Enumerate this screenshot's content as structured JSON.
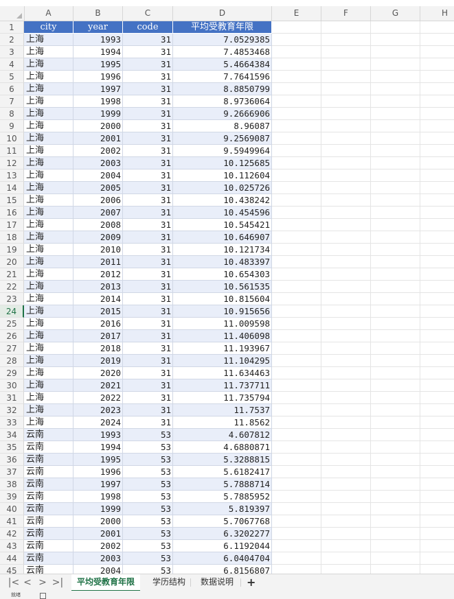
{
  "columns": [
    "A",
    "B",
    "C",
    "D",
    "E",
    "F",
    "G",
    "H"
  ],
  "header_row": {
    "row_number": "1",
    "cells": [
      "city",
      "year",
      "code",
      "平均受教育年限"
    ]
  },
  "rows": [
    {
      "r": "2",
      "city": "上海",
      "year": "1993",
      "code": "31",
      "value": "7.0529385"
    },
    {
      "r": "3",
      "city": "上海",
      "year": "1994",
      "code": "31",
      "value": "7.4853468"
    },
    {
      "r": "4",
      "city": "上海",
      "year": "1995",
      "code": "31",
      "value": "5.4664384"
    },
    {
      "r": "5",
      "city": "上海",
      "year": "1996",
      "code": "31",
      "value": "7.7641596"
    },
    {
      "r": "6",
      "city": "上海",
      "year": "1997",
      "code": "31",
      "value": "8.8850799"
    },
    {
      "r": "7",
      "city": "上海",
      "year": "1998",
      "code": "31",
      "value": "8.9736064"
    },
    {
      "r": "8",
      "city": "上海",
      "year": "1999",
      "code": "31",
      "value": "9.2666906"
    },
    {
      "r": "9",
      "city": "上海",
      "year": "2000",
      "code": "31",
      "value": "8.96087"
    },
    {
      "r": "10",
      "city": "上海",
      "year": "2001",
      "code": "31",
      "value": "9.2569087"
    },
    {
      "r": "11",
      "city": "上海",
      "year": "2002",
      "code": "31",
      "value": "9.5949964"
    },
    {
      "r": "12",
      "city": "上海",
      "year": "2003",
      "code": "31",
      "value": "10.125685"
    },
    {
      "r": "13",
      "city": "上海",
      "year": "2004",
      "code": "31",
      "value": "10.112604"
    },
    {
      "r": "14",
      "city": "上海",
      "year": "2005",
      "code": "31",
      "value": "10.025726"
    },
    {
      "r": "15",
      "city": "上海",
      "year": "2006",
      "code": "31",
      "value": "10.438242"
    },
    {
      "r": "16",
      "city": "上海",
      "year": "2007",
      "code": "31",
      "value": "10.454596"
    },
    {
      "r": "17",
      "city": "上海",
      "year": "2008",
      "code": "31",
      "value": "10.545421"
    },
    {
      "r": "18",
      "city": "上海",
      "year": "2009",
      "code": "31",
      "value": "10.646907"
    },
    {
      "r": "19",
      "city": "上海",
      "year": "2010",
      "code": "31",
      "value": "10.121734"
    },
    {
      "r": "20",
      "city": "上海",
      "year": "2011",
      "code": "31",
      "value": "10.483397"
    },
    {
      "r": "21",
      "city": "上海",
      "year": "2012",
      "code": "31",
      "value": "10.654303"
    },
    {
      "r": "22",
      "city": "上海",
      "year": "2013",
      "code": "31",
      "value": "10.561535"
    },
    {
      "r": "23",
      "city": "上海",
      "year": "2014",
      "code": "31",
      "value": "10.815604"
    },
    {
      "r": "24",
      "city": "上海",
      "year": "2015",
      "code": "31",
      "value": "10.915656"
    },
    {
      "r": "25",
      "city": "上海",
      "year": "2016",
      "code": "31",
      "value": "11.009598"
    },
    {
      "r": "26",
      "city": "上海",
      "year": "2017",
      "code": "31",
      "value": "11.406098"
    },
    {
      "r": "27",
      "city": "上海",
      "year": "2018",
      "code": "31",
      "value": "11.193967"
    },
    {
      "r": "28",
      "city": "上海",
      "year": "2019",
      "code": "31",
      "value": "11.104295"
    },
    {
      "r": "29",
      "city": "上海",
      "year": "2020",
      "code": "31",
      "value": "11.634463"
    },
    {
      "r": "30",
      "city": "上海",
      "year": "2021",
      "code": "31",
      "value": "11.737711"
    },
    {
      "r": "31",
      "city": "上海",
      "year": "2022",
      "code": "31",
      "value": "11.735794"
    },
    {
      "r": "32",
      "city": "上海",
      "year": "2023",
      "code": "31",
      "value": "11.7537"
    },
    {
      "r": "33",
      "city": "上海",
      "year": "2024",
      "code": "31",
      "value": "11.8562"
    },
    {
      "r": "34",
      "city": "云南",
      "year": "1993",
      "code": "53",
      "value": "4.607812"
    },
    {
      "r": "35",
      "city": "云南",
      "year": "1994",
      "code": "53",
      "value": "4.6880871"
    },
    {
      "r": "36",
      "city": "云南",
      "year": "1995",
      "code": "53",
      "value": "5.3288815"
    },
    {
      "r": "37",
      "city": "云南",
      "year": "1996",
      "code": "53",
      "value": "5.6182417"
    },
    {
      "r": "38",
      "city": "云南",
      "year": "1997",
      "code": "53",
      "value": "5.7888714"
    },
    {
      "r": "39",
      "city": "云南",
      "year": "1998",
      "code": "53",
      "value": "5.7885952"
    },
    {
      "r": "40",
      "city": "云南",
      "year": "1999",
      "code": "53",
      "value": "5.819397"
    },
    {
      "r": "41",
      "city": "云南",
      "year": "2000",
      "code": "53",
      "value": "5.7067768"
    },
    {
      "r": "42",
      "city": "云南",
      "year": "2001",
      "code": "53",
      "value": "6.3202277"
    },
    {
      "r": "43",
      "city": "云南",
      "year": "2002",
      "code": "53",
      "value": "6.1192044"
    },
    {
      "r": "44",
      "city": "云南",
      "year": "2003",
      "code": "53",
      "value": "6.0404704"
    },
    {
      "r": "45",
      "city": "云南",
      "year": "2004",
      "code": "53",
      "value": "6.8156807"
    }
  ],
  "active_row": "24",
  "sheet_tabs": [
    "平均受教育年限",
    "学历结构",
    "数据说明"
  ],
  "active_tab": 0,
  "nav_icons": [
    "first-sheet-icon",
    "prev-sheet-icon",
    "next-sheet-icon",
    "last-sheet-icon"
  ],
  "nav_glyphs": [
    "|<",
    "<",
    ">",
    ">|"
  ],
  "add_tab_glyph": "+",
  "status_text": "就绪",
  "colors": {
    "header_fill": "#4472c4",
    "band_fill": "#e9eef9",
    "active_tab": "#1e7145"
  }
}
